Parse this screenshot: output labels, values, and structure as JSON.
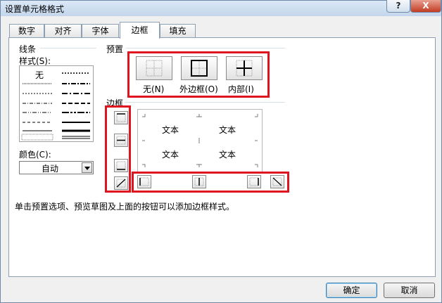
{
  "window": {
    "title": "设置单元格格式",
    "help_label": "?",
    "close_label": "X"
  },
  "tabs": [
    {
      "label": "数字"
    },
    {
      "label": "对齐"
    },
    {
      "label": "字体"
    },
    {
      "label": "边框",
      "active": true
    },
    {
      "label": "填充"
    }
  ],
  "line_group": {
    "title": "线条",
    "style_label": "样式(S):",
    "none_label": "无",
    "color_label": "颜色(C):",
    "color_value": "自动"
  },
  "presets": {
    "title": "预置",
    "items": [
      {
        "icon": "preset-none-icon",
        "label": "无(N)"
      },
      {
        "icon": "preset-outline-icon",
        "label": "外边框(O)"
      },
      {
        "icon": "preset-inside-icon",
        "label": "内部(I)"
      }
    ]
  },
  "border_group": {
    "title": "边框",
    "preview_cells": [
      "文本",
      "文本",
      "文本",
      "文本"
    ]
  },
  "hint": "单击预置选项、预览草图及上面的按钮可以添加边框样式。",
  "buttons": {
    "ok_label": "确定",
    "cancel_label": "取消"
  },
  "colors": {
    "highlight": "#e0141e",
    "accent": "#3c7fb1"
  }
}
